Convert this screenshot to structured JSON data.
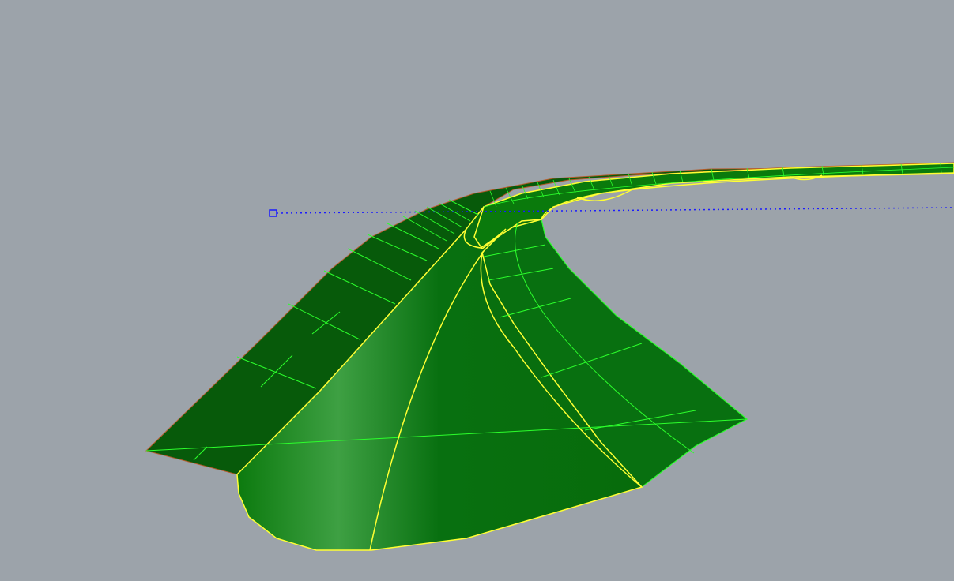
{
  "viewport": {
    "background_color": "#9ca3aa",
    "view": "perspective"
  },
  "model": {
    "surface_color": "#0a6e0c",
    "surface_dark_color": "#075a0a",
    "isocurve_color": "#2cff2c",
    "selected_edge_color": "#ffff33",
    "outline_color": "#b45a28"
  },
  "construction_line": {
    "color": "#1a1aff",
    "style": "dotted",
    "endpoint_marker": "square-grip"
  }
}
